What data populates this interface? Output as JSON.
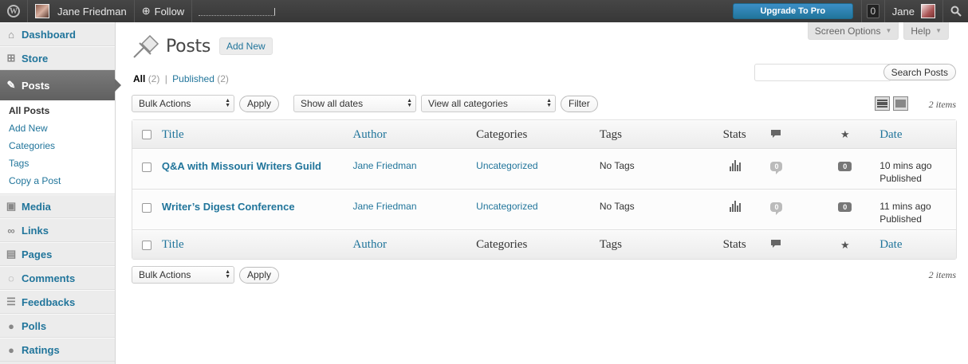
{
  "admin_bar": {
    "site_user": "Jane Friedman",
    "follow": "Follow",
    "upgrade": "Upgrade To Pro",
    "notifications": "0",
    "account": "Jane"
  },
  "sidebar": {
    "items": [
      {
        "label": "Dashboard",
        "icon": "dashboard-icon"
      },
      {
        "label": "Store",
        "icon": "cart-icon"
      },
      {
        "label": "Posts",
        "icon": "pushpin-icon"
      },
      {
        "label": "Media",
        "icon": "media-icon"
      },
      {
        "label": "Links",
        "icon": "link-icon"
      },
      {
        "label": "Pages",
        "icon": "pages-icon"
      },
      {
        "label": "Comments",
        "icon": "comments-icon"
      },
      {
        "label": "Feedbacks",
        "icon": "feedback-icon"
      },
      {
        "label": "Polls",
        "icon": "polls-icon"
      },
      {
        "label": "Ratings",
        "icon": "ratings-icon"
      }
    ],
    "submenu": [
      "All Posts",
      "Add New",
      "Categories",
      "Tags",
      "Copy a Post"
    ]
  },
  "screen_meta": {
    "screen_options": "Screen Options",
    "help": "Help"
  },
  "page": {
    "title": "Posts",
    "add_new": "Add New"
  },
  "filters": {
    "all_label": "All",
    "all_count": "(2)",
    "separator": "|",
    "published_label": "Published",
    "published_count": "(2)"
  },
  "search": {
    "value": "",
    "button": "Search Posts"
  },
  "tablenav_top": {
    "bulk_actions": "Bulk Actions",
    "apply": "Apply",
    "dates": "Show all dates",
    "categories": "View all categories",
    "filter": "Filter",
    "count": "2 items"
  },
  "tablenav_bottom": {
    "bulk_actions": "Bulk Actions",
    "apply": "Apply",
    "count": "2 items"
  },
  "table": {
    "columns": {
      "title": "Title",
      "author": "Author",
      "categories": "Categories",
      "tags": "Tags",
      "stats": "Stats",
      "date": "Date"
    },
    "rows": [
      {
        "title": "Q&A with Missouri Writers Guild",
        "author": "Jane Friedman",
        "categories": "Uncategorized",
        "tags": "No Tags",
        "comments": "0",
        "rating": "0",
        "date": "10 mins ago",
        "status": "Published"
      },
      {
        "title": "Writer’s Digest Conference",
        "author": "Jane Friedman",
        "categories": "Uncategorized",
        "tags": "No Tags",
        "comments": "0",
        "rating": "0",
        "date": "11 mins ago",
        "status": "Published"
      }
    ]
  }
}
